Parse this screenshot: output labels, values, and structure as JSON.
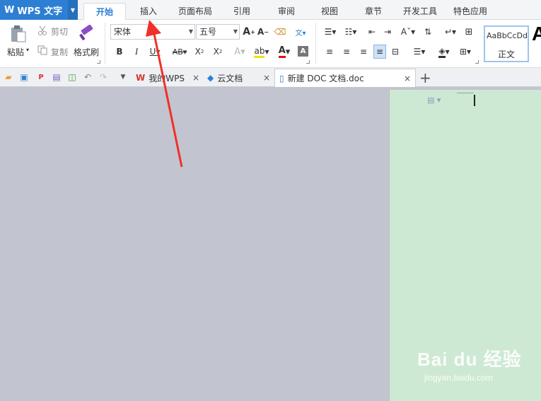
{
  "app": {
    "name": "WPS 文字",
    "logo": "W"
  },
  "menu_tabs": [
    {
      "label": "开始",
      "active": true
    },
    {
      "label": "插入"
    },
    {
      "label": "页面布局"
    },
    {
      "label": "引用"
    },
    {
      "label": "审阅"
    },
    {
      "label": "视图"
    },
    {
      "label": "章节"
    },
    {
      "label": "开发工具"
    },
    {
      "label": "特色应用"
    }
  ],
  "ribbon": {
    "paste": "粘贴",
    "cut": "剪切",
    "copy": "复制",
    "format_painter": "格式刷",
    "font_name": "宋体",
    "font_size": "五号",
    "style_sample": "AaBbCcDd",
    "style_name": "正文",
    "style_next_sample": "A"
  },
  "doc_tabs": [
    {
      "label": "我的WPS"
    },
    {
      "label": "云文档"
    },
    {
      "label": "新建 DOC 文档.doc",
      "active": true
    }
  ],
  "watermark": {
    "brand": "Bai du 经验",
    "url": "jingyan.baidu.com"
  },
  "colors": {
    "accent": "#2d7fd3",
    "page": "#cde9d3",
    "canvas": "#c2c5cf",
    "arrow": "#f0302a"
  }
}
